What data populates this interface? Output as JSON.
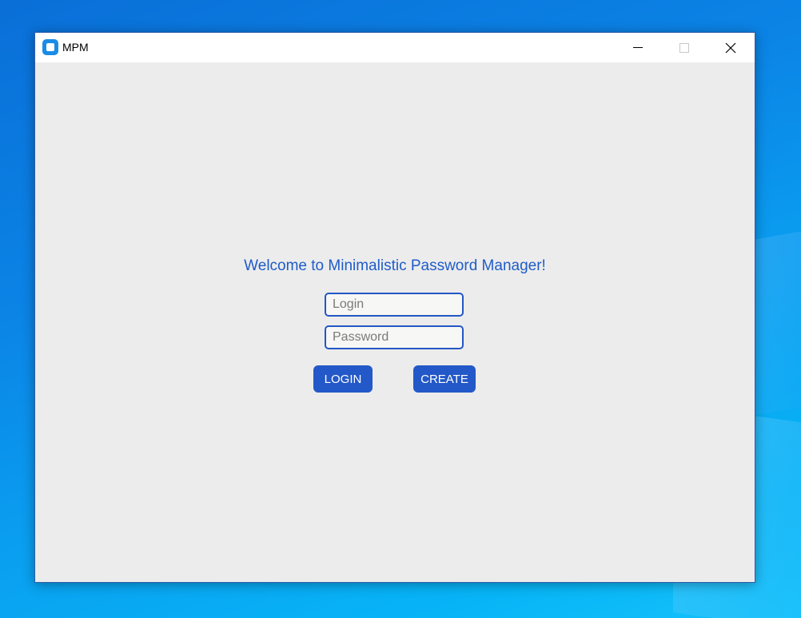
{
  "window": {
    "title": "MPM"
  },
  "main": {
    "welcome_text": "Welcome to Minimalistic Password Manager!",
    "login_placeholder": "Login",
    "login_value": "",
    "password_placeholder": "Password",
    "password_value": "",
    "login_button": "LOGIN",
    "create_button": "CREATE"
  },
  "colors": {
    "accent": "#2358c8",
    "background": "#ececec",
    "desktop": "#0a8fe8"
  }
}
